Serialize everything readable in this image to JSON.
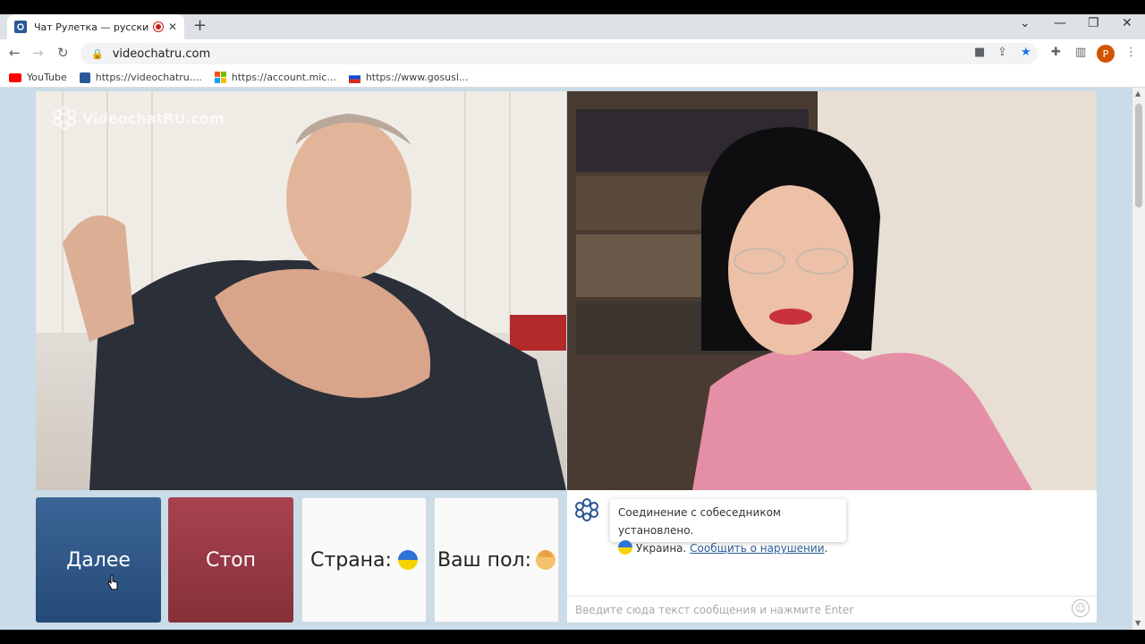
{
  "browser": {
    "tab": {
      "title": "Чат Рулетка — русский вид",
      "close": "✕"
    },
    "new_tab": "+",
    "window": {
      "minimize": "—",
      "restore": "❐",
      "close": "✕",
      "tabs_menu": "⌄"
    },
    "nav": {
      "back": "←",
      "forward": "→",
      "reload": "↻"
    },
    "url": "videochatru.com",
    "profile_initial": "P",
    "bookmarks": [
      {
        "label": "YouTube",
        "icon": "youtube-icon",
        "color": "#ff0000"
      },
      {
        "label": "https://videochatru....",
        "icon": "videochat-icon",
        "color": "#2b5797"
      },
      {
        "label": "https://account.mic...",
        "icon": "microsoft-icon",
        "color": "#f25022"
      },
      {
        "label": "https://www.gosusl...",
        "icon": "gosuslugi-icon",
        "color": "#0d4cd3"
      }
    ]
  },
  "page": {
    "watermark": "VideochatRU.com",
    "buttons": {
      "next": "Далее",
      "stop": "Стоп",
      "country": "Страна:",
      "gender": "Ваш пол:"
    },
    "chat": {
      "status": "Соединение с собеседником установлено.",
      "country": "Украина.",
      "report": "Сообщить о нарушении",
      "report_end": ".",
      "input_placeholder": "Введите сюда текст сообщения и нажмите Enter"
    },
    "colors": {
      "next": "#2f5a8c",
      "stop": "#9a3a45",
      "page_bg": "#c9dce7"
    }
  }
}
